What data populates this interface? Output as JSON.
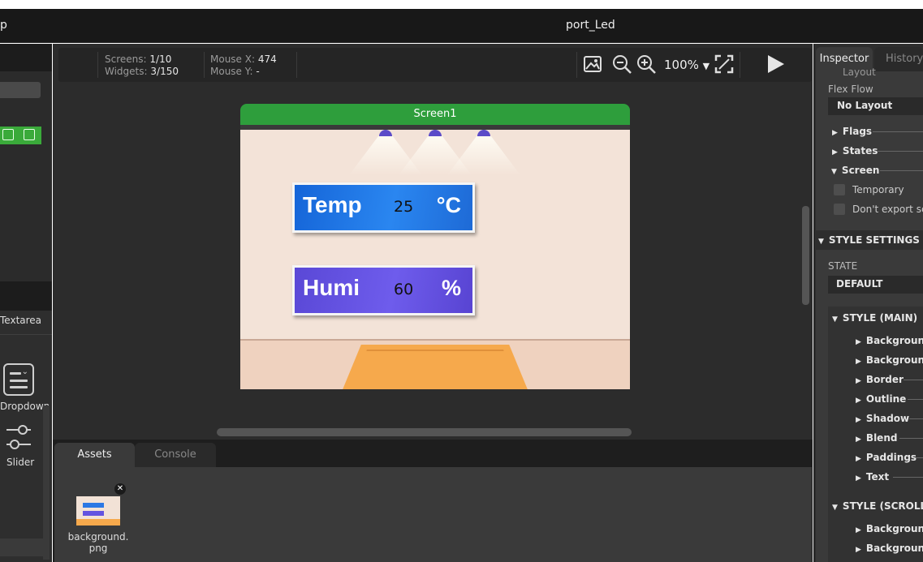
{
  "window": {
    "title_left": "p",
    "title_center": "port_Led"
  },
  "left_panel": {
    "widgets": [
      {
        "label": "Textarea"
      },
      {
        "label": "Dropdown",
        "icon": "dropdown-icon"
      },
      {
        "label": "Slider",
        "icon": "slider-icon"
      }
    ]
  },
  "toolbar": {
    "screens_label": "Screens:",
    "screens_value": "1/10",
    "widgets_label": "Widgets:",
    "widgets_value": "3/150",
    "mouse_x_label": "Mouse X:",
    "mouse_x_value": "474",
    "mouse_y_label": "Mouse Y:",
    "mouse_y_value": "-",
    "zoom": "100%"
  },
  "screen": {
    "name": "Screen1",
    "cards": [
      {
        "label": "Temp",
        "value": "25",
        "unit": "°C"
      },
      {
        "label": "Humi",
        "value": "60",
        "unit": "%"
      }
    ]
  },
  "bottom": {
    "tabs": [
      "Assets",
      "Console"
    ],
    "assets": [
      {
        "name": "background.png"
      }
    ]
  },
  "inspector": {
    "tabs": [
      "Inspector",
      "History"
    ],
    "layout_label": "Layout",
    "flex_flow_label": "Flex Flow",
    "flex_flow_value": "No Layout",
    "sections": [
      "Flags",
      "States",
      "Screen"
    ],
    "screen_options": [
      "Temporary",
      "Don't export scr"
    ],
    "style_settings": "STYLE SETTINGS",
    "state_label": "STATE",
    "state_value": "DEFAULT",
    "style_main": "STYLE (MAIN)",
    "style_main_items": [
      "Background",
      "Background",
      "Border",
      "Outline",
      "Shadow",
      "Blend",
      "Paddings",
      "Text"
    ],
    "style_scrollbar": "STYLE (SCROLLBA",
    "style_scrollbar_items": [
      "Background",
      "Background"
    ]
  },
  "colors": {
    "accent_green": "#2e9e3c",
    "temp_card": "#1565d8",
    "humi_card": "#5a48d6"
  }
}
